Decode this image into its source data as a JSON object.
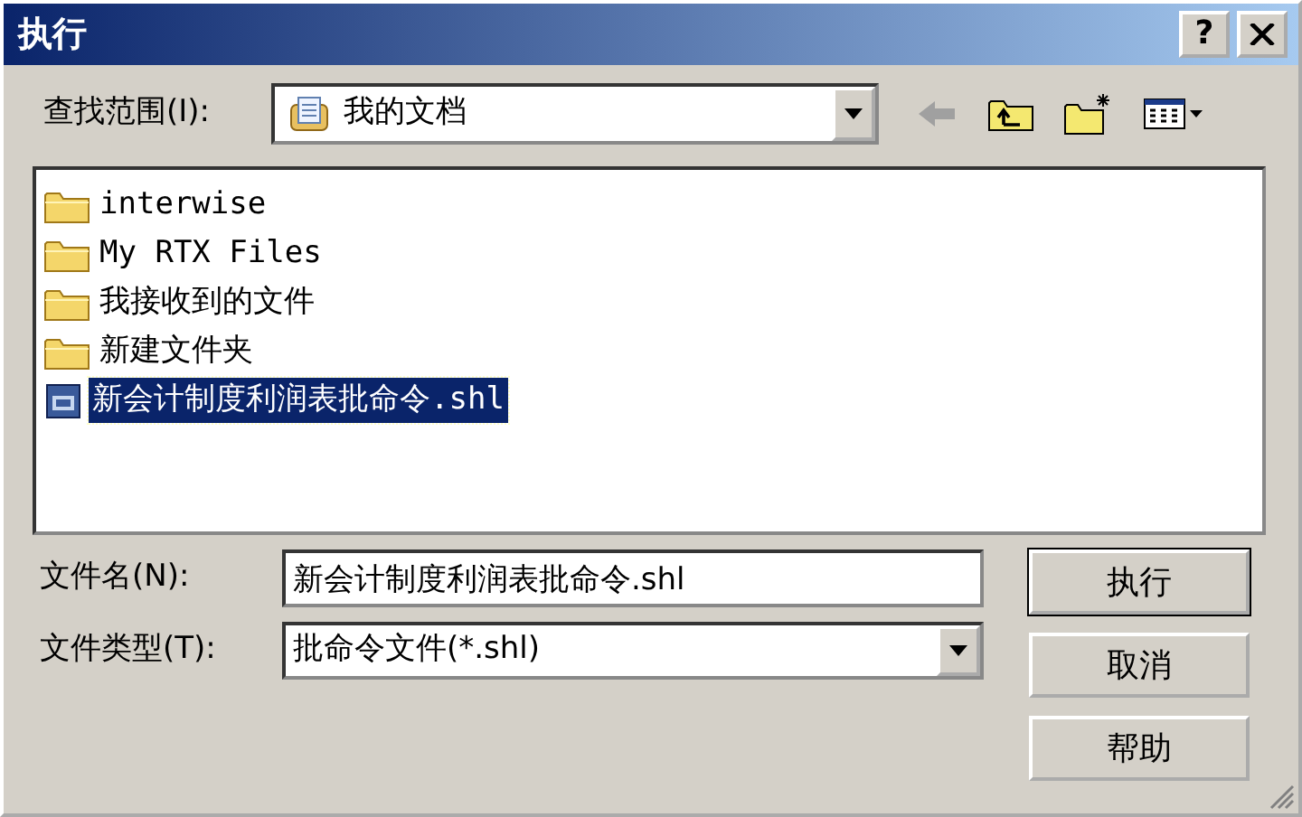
{
  "window": {
    "title": "执行",
    "controls": [
      {
        "kind": "help",
        "label": "?"
      },
      {
        "kind": "close"
      }
    ]
  },
  "look_in": {
    "label": "查找范围(I):",
    "value": "我的文档"
  },
  "toolbar": [
    {
      "kind": "back",
      "disabled": true
    },
    {
      "kind": "up",
      "disabled": false
    },
    {
      "kind": "new-folder",
      "disabled": false
    },
    {
      "kind": "view-menu",
      "disabled": false
    }
  ],
  "files": [
    {
      "name": "interwise",
      "kind": "folder",
      "selected": false
    },
    {
      "name": "My RTX Files",
      "kind": "folder",
      "selected": false
    },
    {
      "name": "我接收到的文件",
      "kind": "folder",
      "selected": false
    },
    {
      "name": "新建文件夹",
      "kind": "folder",
      "selected": false
    },
    {
      "name": "新会计制度利润表批命令.shl",
      "kind": "file",
      "selected": true
    }
  ],
  "file_name": {
    "label": "文件名(N):",
    "value": "新会计制度利润表批命令.shl"
  },
  "file_type": {
    "label": "文件类型(T):",
    "value": "批命令文件(*.shl)"
  },
  "buttons": [
    {
      "label": "执行",
      "default": true
    },
    {
      "label": "取消",
      "default": false
    },
    {
      "label": "帮助",
      "default": false
    }
  ]
}
